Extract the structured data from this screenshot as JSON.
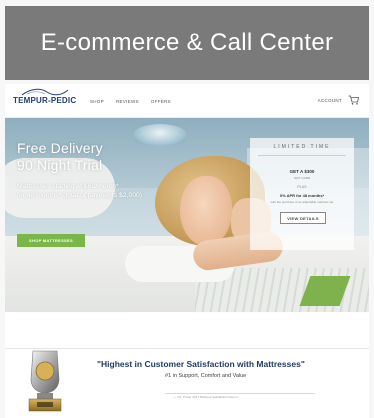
{
  "slide": {
    "title": "E-commerce & Call Center"
  },
  "nav": {
    "logo": "TEMPUR-PEDIC",
    "links": [
      "SHOP",
      "REVIEWS",
      "OFFERS"
    ],
    "account": "ACCOUNT",
    "cart_icon": "cart-icon"
  },
  "hero": {
    "line1": "Free Delivery",
    "line2": "90 Night Trial",
    "subline1": "Mattresses starting at $62/month*",
    "subline2": "for 48 months* (total of payments $2,000)",
    "cta": "SHOP MATTRESSES"
  },
  "promo": {
    "heading": "LIMITED TIME",
    "offer": "GET A $300",
    "offer_sub": "GIFT CARD",
    "plus": "PLUS",
    "apr": "0% APR for 48 months*",
    "apr_sub": "with the purchase of an adjustable mattress set",
    "button": "VIEW DETAILS"
  },
  "award": {
    "quote": "\"Highest in Customer Satisfaction with Mattresses\"",
    "sub1": "#1 in Support, Comfort and Value",
    "sub2": "",
    "source": "— J.D. Power 2017 Mattress Satisfaction Report"
  },
  "colors": {
    "title_bar": "#7a7a7a",
    "brand_blue": "#243a7a",
    "cta_green": "#7ab648",
    "award_blue": "#1f3a6b"
  }
}
